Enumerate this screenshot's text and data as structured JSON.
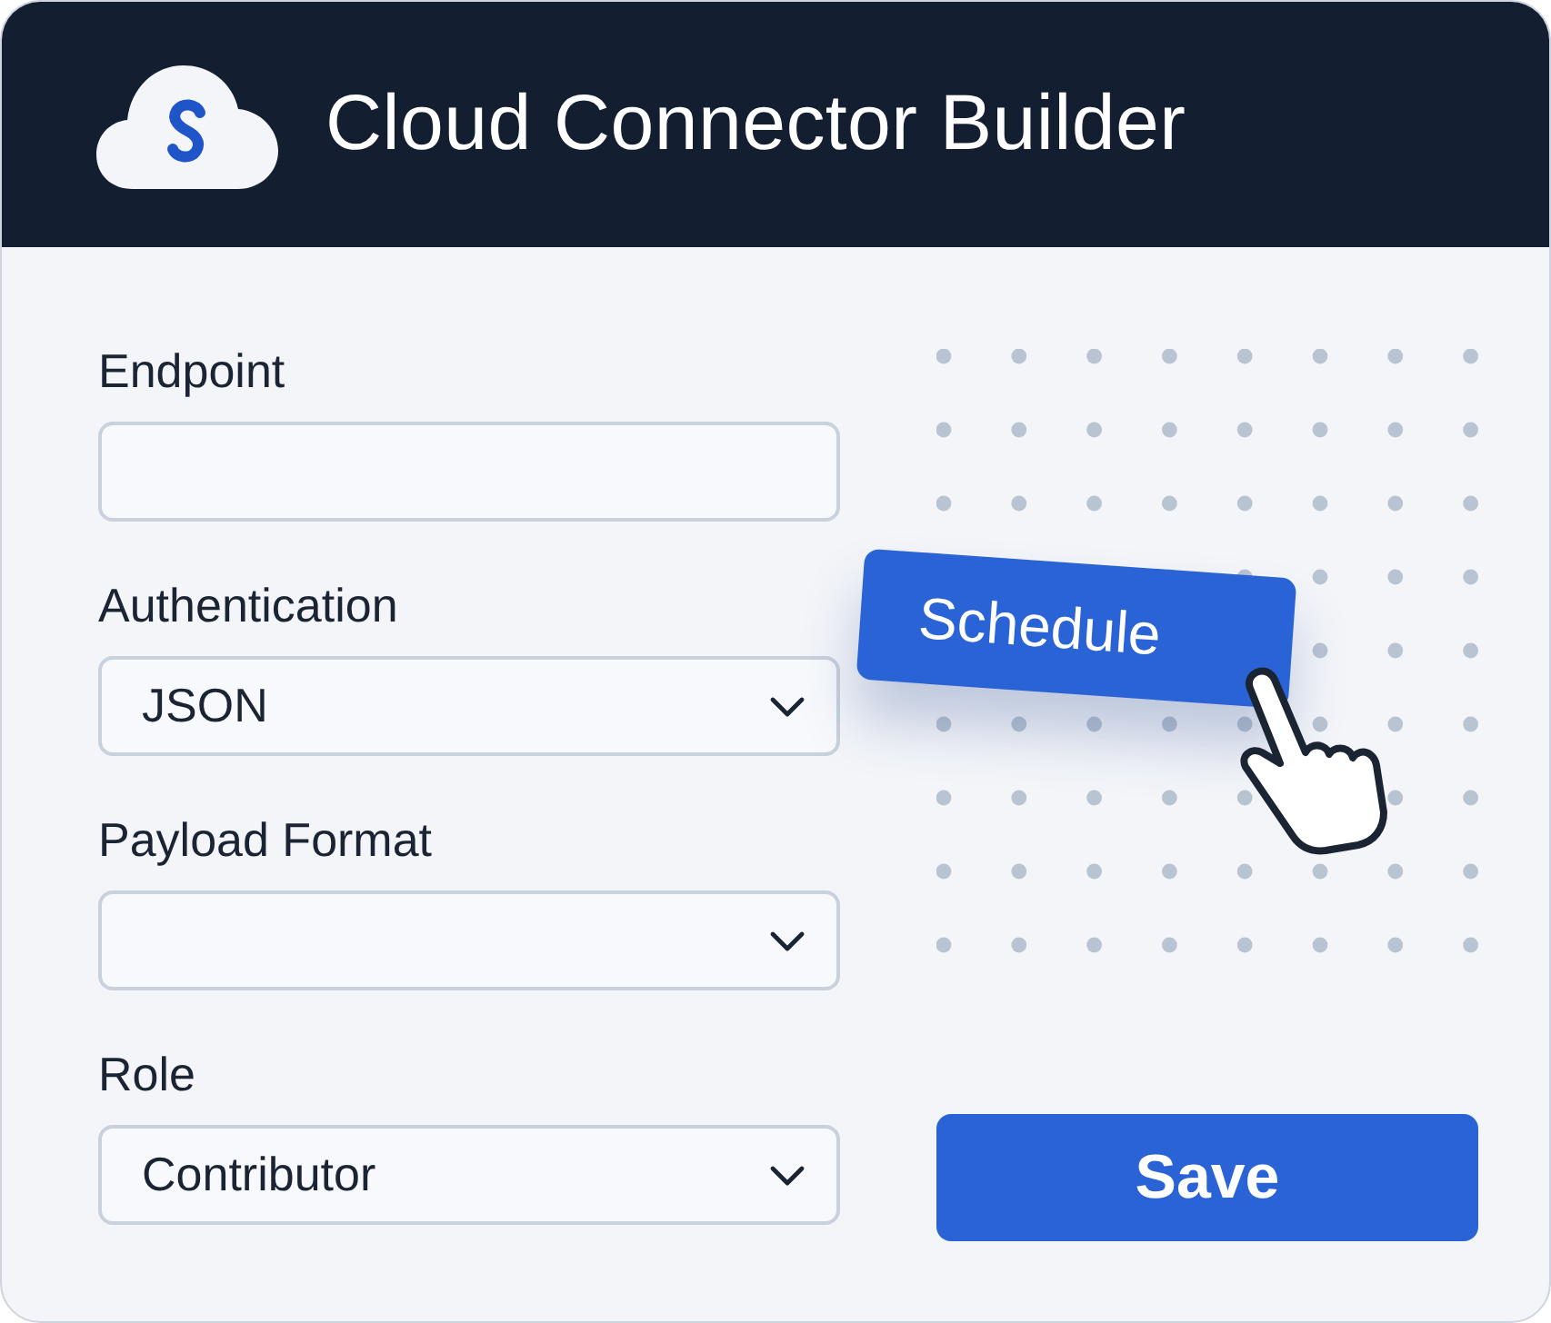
{
  "header": {
    "title": "Cloud Connector Builder"
  },
  "fields": [
    {
      "label": "Endpoint",
      "kind": "text"
    },
    {
      "label": "Authentication",
      "kind": "select",
      "value": "JSON"
    },
    {
      "label": "Payload Format",
      "kind": "select"
    },
    {
      "label": "Role",
      "kind": "select",
      "value": "Contributor"
    }
  ],
  "floating_button": {
    "label": "Schedule"
  },
  "save_button": {
    "label": "Save"
  }
}
